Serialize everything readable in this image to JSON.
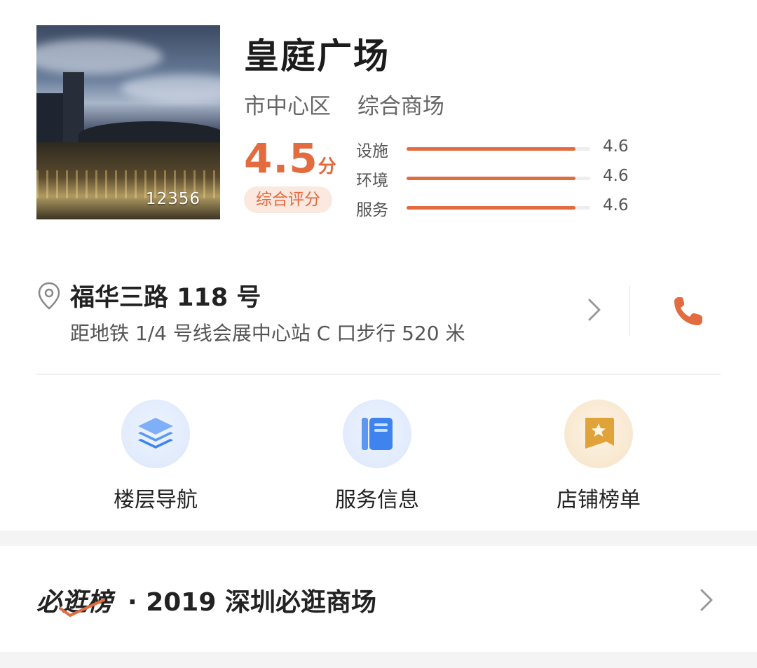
{
  "mall": {
    "name": "皇庭广场",
    "district": "市中心区",
    "category": "综合商场",
    "photo_count": "12356",
    "score": "4.5",
    "score_unit": "分",
    "score_label": "综合评分",
    "ratings": [
      {
        "label": "设施",
        "value": "4.6",
        "fraction": 0.92
      },
      {
        "label": "环境",
        "value": "4.6",
        "fraction": 0.92
      },
      {
        "label": "服务",
        "value": "4.6",
        "fraction": 0.92
      }
    ]
  },
  "address": {
    "street": "福华三路 118 号",
    "directions": "距地铁 1/4 号线会展中心站 C 口步行 520 米"
  },
  "actions": [
    {
      "label": "楼层导航",
      "icon": "layers-icon"
    },
    {
      "label": "服务信息",
      "icon": "notebook-icon"
    },
    {
      "label": "店铺榜单",
      "icon": "star-flag-icon"
    }
  ],
  "ranking": {
    "logo": "必逛榜",
    "text": "· 2019 深圳必逛商场"
  },
  "colors": {
    "accent": "#e26b3f",
    "accent_light": "#fbe8df",
    "blue": "#4f8ff0",
    "gold": "#e0a33a"
  }
}
